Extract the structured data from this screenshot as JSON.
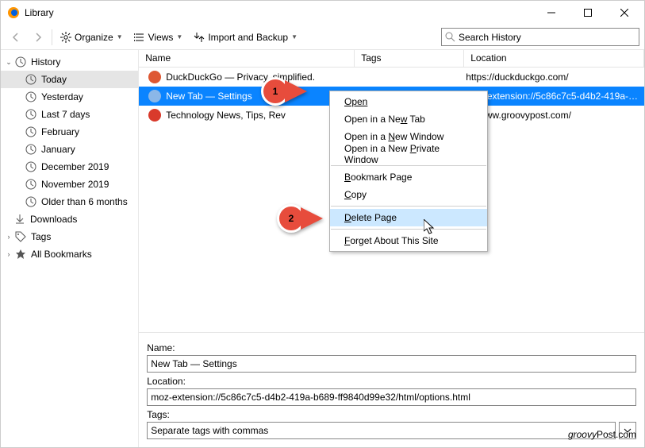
{
  "window": {
    "title": "Library"
  },
  "toolbar": {
    "organize": "Organize",
    "views": "Views",
    "import": "Import and Backup",
    "search_placeholder": "Search History"
  },
  "sidebar": {
    "history": "History",
    "items": [
      "Today",
      "Yesterday",
      "Last 7 days",
      "February",
      "January",
      "December 2019",
      "November 2019",
      "Older than 6 months"
    ],
    "downloads": "Downloads",
    "tags": "Tags",
    "bookmarks": "All Bookmarks"
  },
  "columns": {
    "name": "Name",
    "tags": "Tags",
    "location": "Location"
  },
  "rows": [
    {
      "title": "DuckDuckGo — Privacy, simplified.",
      "loc": "https://duckduckgo.com/",
      "fav": "#de5833"
    },
    {
      "title": "New Tab — Settings",
      "loc": "moz-extension://5c86c7c5-d4b2-419a-…",
      "fav": "#8bb7e8",
      "selected": true
    },
    {
      "title": "Technology News, Tips, Rev",
      "loc": "s://www.groovypost.com/",
      "fav": "#d93a2b"
    }
  ],
  "context_menu": {
    "open": "Open",
    "open_tab_pre": "Open in a Ne",
    "open_tab_u": "w",
    "open_tab_post": " Tab",
    "open_win_pre": "Open in a ",
    "open_win_u": "N",
    "open_win_post": "ew Window",
    "open_priv_pre": "Open in a New ",
    "open_priv_u": "P",
    "open_priv_post": "rivate Window",
    "bookmark_u": "B",
    "bookmark_post": "ookmark Page",
    "copy_u": "C",
    "copy_post": "opy",
    "delete_u": "D",
    "delete_post": "elete Page",
    "forget_u": "F",
    "forget_post": "orget About This Site"
  },
  "details": {
    "name_label": "Name:",
    "name_value": "New Tab — Settings",
    "loc_label": "Location:",
    "loc_value": "moz-extension://5c86c7c5-d4b2-419a-b689-ff9840d99e32/html/options.html",
    "tags_label": "Tags:",
    "tags_placeholder": "Separate tags with commas"
  },
  "callouts": {
    "one": "1",
    "two": "2"
  },
  "watermark": {
    "a": "groovy",
    "b": "Post",
    "c": ".com"
  }
}
